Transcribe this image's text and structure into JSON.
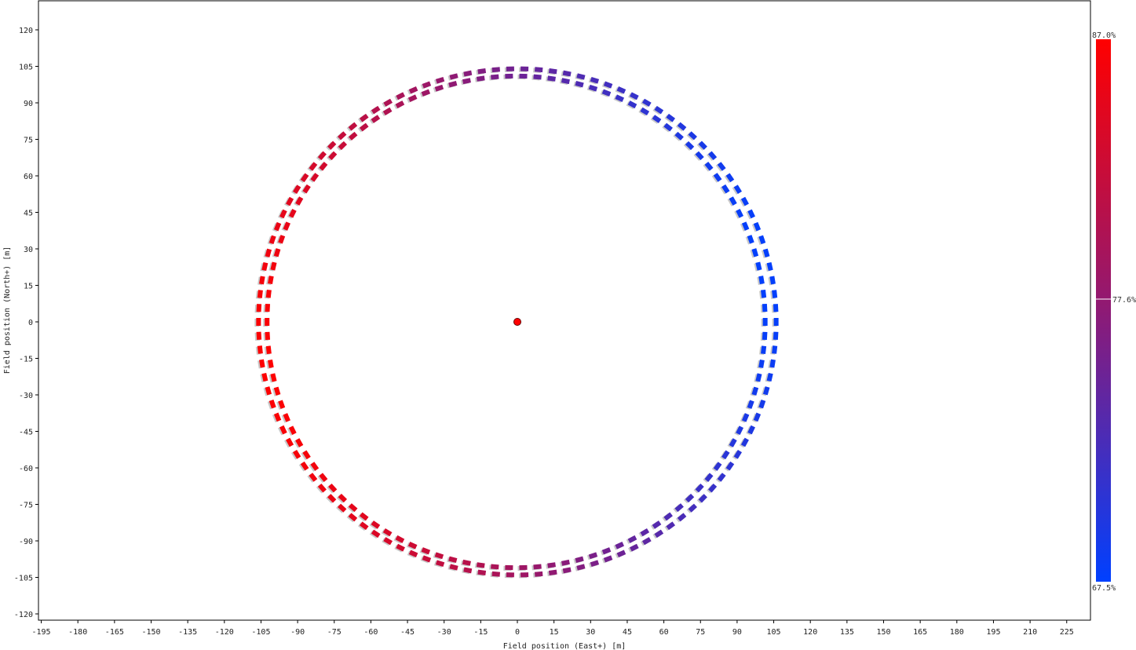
{
  "chart_data": {
    "type": "scatter",
    "xlabel": "Field position (East+) [m]",
    "ylabel": "Field position (North+) [m]",
    "xlim": [
      -195,
      225
    ],
    "ylim": [
      -120,
      120
    ],
    "x_ticks": [
      "-195",
      "-180",
      "-165",
      "-150",
      "-135",
      "-120",
      "-105",
      "-90",
      "-75",
      "-60",
      "-45",
      "-30",
      "-15",
      "0",
      "15",
      "30",
      "45",
      "60",
      "75",
      "90",
      "105",
      "120",
      "135",
      "150",
      "165",
      "180",
      "195",
      "210",
      "225"
    ],
    "y_ticks": [
      "120",
      "105",
      "90",
      "75",
      "60",
      "45",
      "30",
      "15",
      "0",
      "-15",
      "-30",
      "-45",
      "-60",
      "-75",
      "-90",
      "-105",
      "-120"
    ],
    "grid": false,
    "colorbar": {
      "max_label": "87.0%",
      "mid_label": "77.6%",
      "min_label": "67.5%",
      "max": 87.0,
      "mid": 77.6,
      "min": 67.5,
      "color_high": "#ff0000",
      "color_mid": "#8e1a75",
      "color_low": "#0040ff"
    },
    "tower": {
      "x": 0,
      "y": 0,
      "color": "#ff0000"
    },
    "heliostat_field": {
      "layout": "two concentric elliptical rings",
      "rings": [
        {
          "center_x": -0.5,
          "semi_axis_x": 102,
          "semi_axis_y": 101,
          "count": 110
        },
        {
          "center_x": 0,
          "semi_axis_x": 106,
          "semi_axis_y": 104,
          "count": 114
        }
      ],
      "efficiency_pattern": "highest on the west side, lowest on the east / south-east side",
      "efficiency_range": [
        67.5,
        87.0
      ]
    }
  }
}
